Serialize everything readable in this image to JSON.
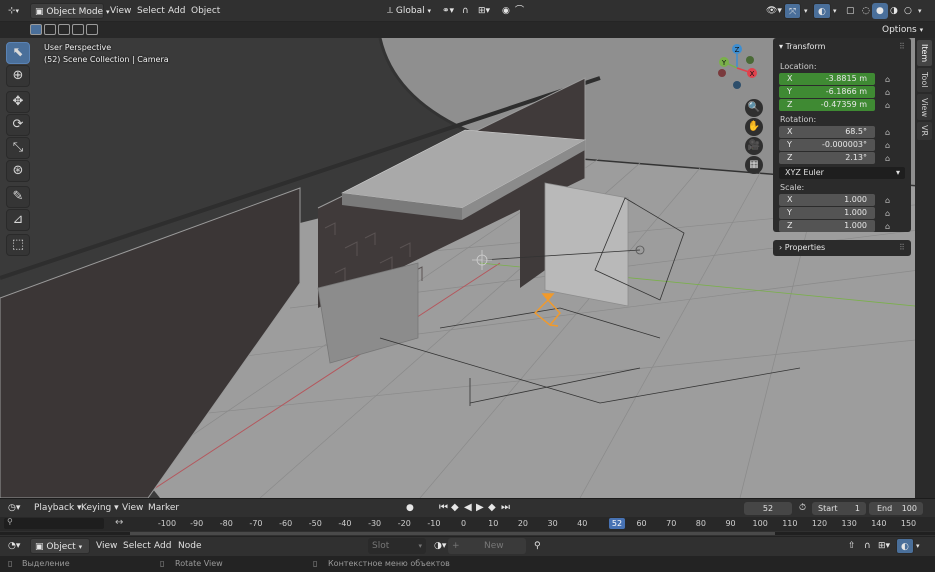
{
  "header": {
    "mode_label": "Object Mode",
    "menus": [
      "View",
      "Select",
      "Add",
      "Object"
    ],
    "transform_orientation": "Global",
    "options_label": "Options"
  },
  "viewport": {
    "view_name": "User Perspective",
    "collection_info": "(52) Scene Collection | Camera",
    "gizmo_axes": [
      "X",
      "Y",
      "Z"
    ]
  },
  "sidebar": {
    "tabs": [
      "Item",
      "Tool",
      "View",
      "VR"
    ],
    "transform_title": "Transform",
    "location_label": "Location:",
    "location": [
      {
        "axis": "X",
        "value": "-3.8815 m"
      },
      {
        "axis": "Y",
        "value": "-6.1866 m"
      },
      {
        "axis": "Z",
        "value": "-0.47359 m"
      }
    ],
    "rotation_label": "Rotation:",
    "rotation": [
      {
        "axis": "X",
        "value": "68.5°"
      },
      {
        "axis": "Y",
        "value": "-0.000003°"
      },
      {
        "axis": "Z",
        "value": "2.13°"
      }
    ],
    "rotation_mode": "XYZ Euler",
    "scale_label": "Scale:",
    "scale": [
      {
        "axis": "X",
        "value": "1.000"
      },
      {
        "axis": "Y",
        "value": "1.000"
      },
      {
        "axis": "Z",
        "value": "1.000"
      }
    ],
    "properties_title": "Properties"
  },
  "timeline": {
    "menus": [
      "Playback",
      "Keying",
      "View",
      "Marker"
    ],
    "current_frame": "52",
    "start_label": "Start",
    "start_value": "1",
    "end_label": "End",
    "end_value": "100",
    "ticks": [
      "-100",
      "-90",
      "-80",
      "-70",
      "-60",
      "-50",
      "-40",
      "-30",
      "-20",
      "-10",
      "0",
      "10",
      "20",
      "30",
      "40",
      "50",
      "60",
      "70",
      "80",
      "90",
      "100",
      "110",
      "120",
      "130",
      "140",
      "150"
    ]
  },
  "editor_bar": {
    "context_label": "Object",
    "menus": [
      "View",
      "Select",
      "Add",
      "Node"
    ],
    "slot_label": "Slot",
    "new_label": "New"
  },
  "statusbar": {
    "items": [
      "Выделение",
      "Rotate View",
      "Контекстное меню объектов"
    ]
  },
  "colors": {
    "accent_blue": "#4a6f9a",
    "field_green": "#3f8a33",
    "frame_marker": "#4772b3",
    "axis_x": "#e0424d",
    "axis_y": "#7ab04a",
    "axis_z": "#3e8ed0"
  }
}
